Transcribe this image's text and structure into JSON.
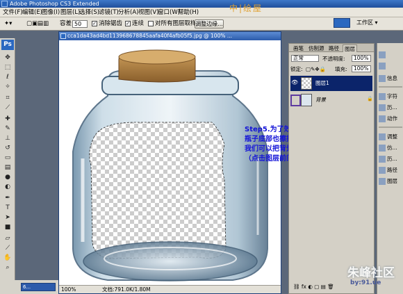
{
  "app": {
    "title": "Adobe Photoshop CS3 Extended",
    "watermark_top": "中|绘屋"
  },
  "menu": [
    "文件(F)",
    "编辑(E)",
    "图像(I)",
    "图层(L)",
    "选择(S)",
    "滤镜(T)",
    "分析(A)",
    "视图(V)",
    "窗口(W)",
    "帮助(H)"
  ],
  "options": {
    "tolerance_label": "容差:",
    "tolerance_value": "50",
    "anti_alias": "消除锯齿",
    "contiguous": "连续",
    "sample_all": "对所有图层取样",
    "refine_edge": "调整边缘...",
    "workspace": "工作区 ▾"
  },
  "document": {
    "title": "cca1da43ad4bd113968678845aafa40f4afb05f5.jpg @ 100% ...",
    "zoom": "100%",
    "doc_info": "文档:791.0K/1.80M"
  },
  "step_text": {
    "line1": "Step5.为了效果更好，用橡皮把",
    "line2": "瓶子底部也擦掉，为了看的更清楚",
    "line3": "我们可以把背景隐藏掉",
    "line4": "（点击图层前的小眼睛即可）"
  },
  "layers_panel": {
    "tabs": [
      "画笔",
      "仿制源",
      "路径",
      "图层"
    ],
    "blend_mode": "正常",
    "opacity_label": "不透明度:",
    "opacity_value": "100%",
    "lock_label": "锁定:",
    "fill_label": "填充:",
    "fill_value": "100%",
    "layers": [
      {
        "name": "图层1",
        "selected": true
      },
      {
        "name": "背景",
        "selected": false
      }
    ]
  },
  "dock": [
    "导航器",
    "信息",
    "字符",
    "历...",
    "动作",
    "调整",
    "仿...",
    "历...",
    "路径",
    "图层"
  ],
  "taskbar": {
    "item": "6..."
  },
  "site_watermark": {
    "text": "朱峰社区",
    "url": "by:91.ue"
  },
  "colors": {
    "foreground": "#e80f12",
    "background": "#ffffff",
    "annotation": "#1212d8"
  }
}
